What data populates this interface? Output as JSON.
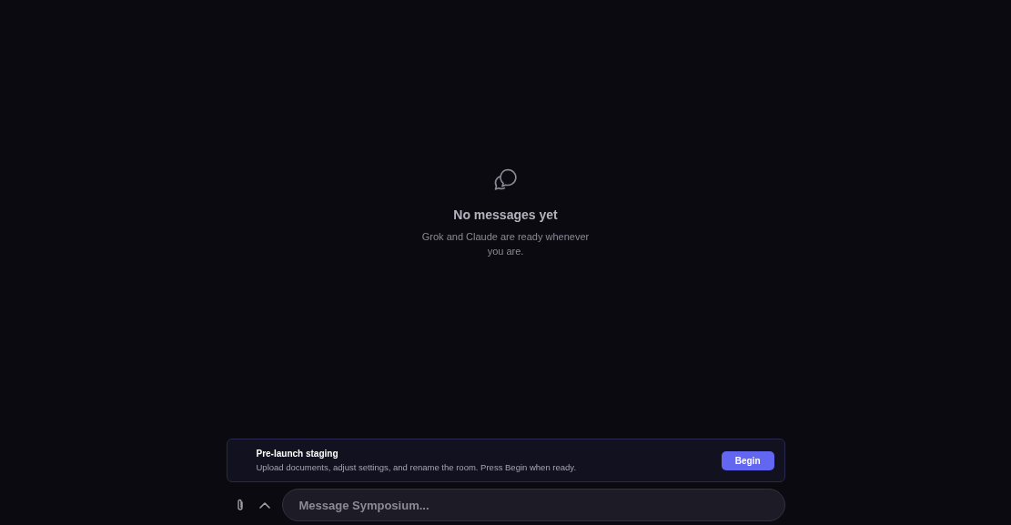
{
  "empty_state": {
    "title": "No messages yet",
    "subtitle": "Grok and Claude are ready whenever you are."
  },
  "staging_banner": {
    "title": "Pre-launch staging",
    "description": "Upload documents, adjust settings, and rename the room. Press Begin when ready.",
    "button": "Begin"
  },
  "composer": {
    "placeholder": "Message Symposium..."
  }
}
